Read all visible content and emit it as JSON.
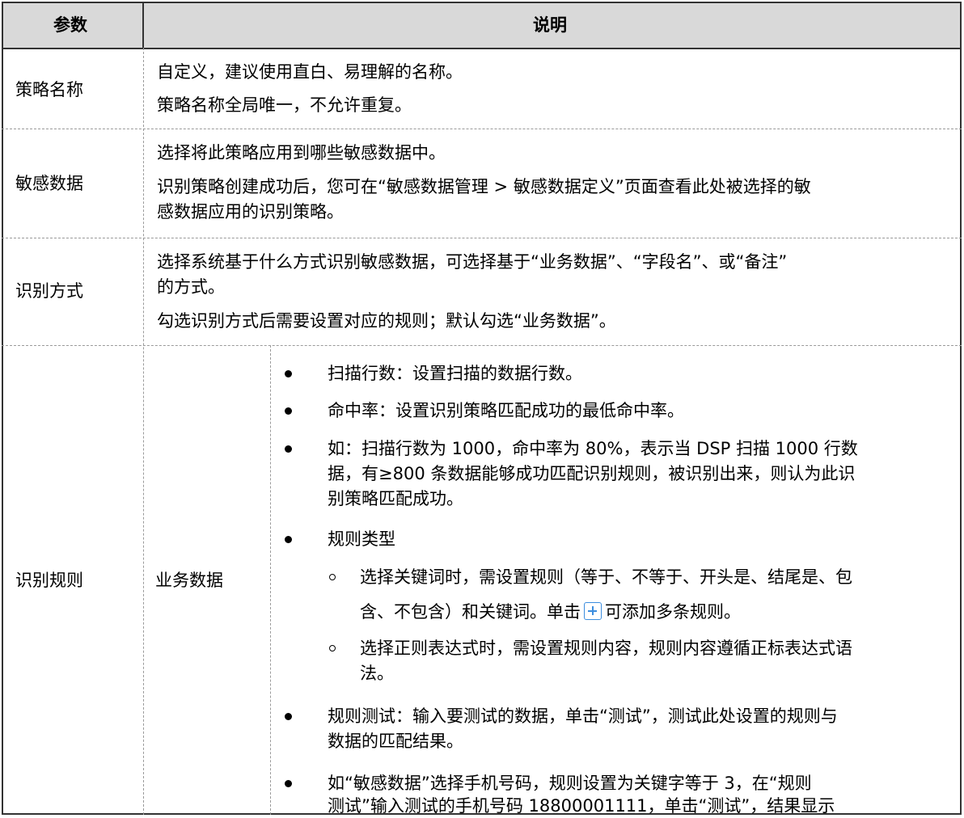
{
  "header": {
    "param": "参数",
    "desc": "说明"
  },
  "rows": {
    "name": {
      "param": "策略名称",
      "lines": [
        "自定义，建议使用直白、易理解的名称。",
        "策略名称全局唯一，不允许重复。"
      ]
    },
    "sensitive": {
      "param": "敏感数据",
      "lines": [
        "选择将此策略应用到哪些敏感数据中。",
        "识别策略创建成功后，您可在“敏感数据管理 > 敏感数据定义”页面查看此处被选择的敏",
        "感数据应用的识别策略。"
      ]
    },
    "method": {
      "param": "识别方式",
      "lines": [
        "选择系统基于什么方式识别敏感数据，可选择基于“业务数据”、“字段名”、或“备注”",
        "的方式。",
        "勾选识别方式后需要设置对应的规则；默认勾选“业务数据”。"
      ]
    },
    "rule": {
      "param": "识别规则",
      "sub_param": "业务数据",
      "items": {
        "scan_rows": "扫描行数：设置扫描的数据行数。",
        "hit_rate": "命中率：设置识别策略匹配成功的最低命中率。",
        "example": [
          "如：扫描行数为 1000，命中率为 80%，表示当 DSP 扫描 1000 行数",
          "据，有≥800 条数据能够成功匹配识别规则，被识别出来，则认为此识",
          "别策略匹配成功。"
        ],
        "rule_type": "规则类型",
        "keyword": {
          "line1": "选择关键词时，需设置规则（等于、不等于、开头是、结尾是、包",
          "line2_before": "含、不包含）和关键词。单击",
          "line2_after": "可添加多条规则。",
          "icon": "plus-icon"
        },
        "regex": [
          "选择正则表达式时，需设置规则内容，规则内容遵循正标表达式语",
          "法。"
        ],
        "test": [
          "规则测试：输入要测试的数据，单击“测试”，测试此处设置的规则与",
          "数据的匹配结果。"
        ],
        "phone": [
          "如“敏感数据”选择手机号码，规则设置为关键字等于 3，在“规则",
          "测试”输入测试的手机号码 18800001111，单击“测试”，结果显示"
        ]
      }
    }
  }
}
